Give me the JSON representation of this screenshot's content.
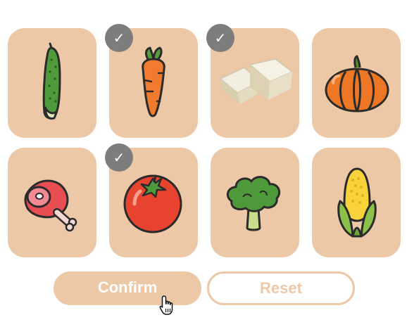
{
  "colors": {
    "card_bg": "#edc8a6",
    "check_bg": "#7d7d7d"
  },
  "cards": [
    {
      "item": "cucumber",
      "icon": "cucumber-icon",
      "selected": false
    },
    {
      "item": "carrot",
      "icon": "carrot-icon",
      "selected": true,
      "check": "✓"
    },
    {
      "item": "tofu",
      "icon": "tofu-icon",
      "selected": true,
      "check": "✓"
    },
    {
      "item": "pumpkin",
      "icon": "pumpkin-icon",
      "selected": false
    },
    {
      "item": "ham",
      "icon": "ham-icon",
      "selected": false
    },
    {
      "item": "tomato",
      "icon": "tomato-icon",
      "selected": true,
      "check": "✓"
    },
    {
      "item": "broccoli",
      "icon": "broccoli-icon",
      "selected": false
    },
    {
      "item": "corn",
      "icon": "corn-icon",
      "selected": false
    }
  ],
  "buttons": {
    "confirm_label": "Confirm",
    "reset_label": "Reset"
  },
  "cursor_icon": "hand-pointer-icon"
}
